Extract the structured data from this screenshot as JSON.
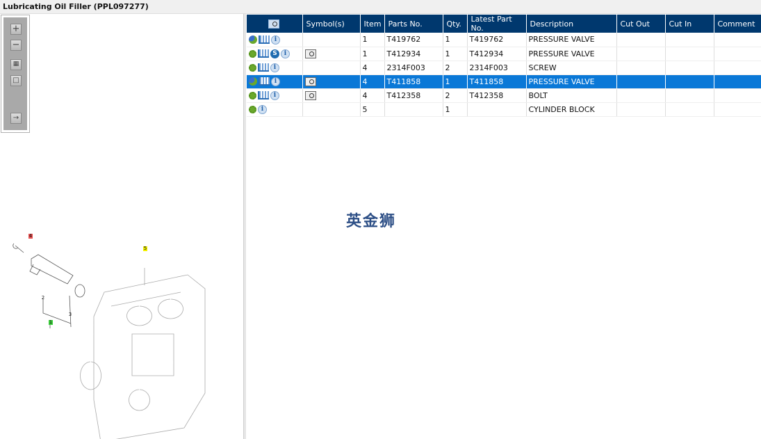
{
  "window": {
    "title": "Lubricating Oil Filler (PPL097277)"
  },
  "toolbar": {
    "tools": [
      "zoom-in",
      "zoom-out",
      "fit-all",
      "fit-window",
      "toggle-panel"
    ]
  },
  "diagram": {
    "callouts": [
      "4",
      "5",
      "1",
      "2",
      "3"
    ],
    "colors": {
      "4": "#e85050",
      "5": "#f2f000",
      "1": "#3bd13b"
    }
  },
  "table": {
    "headers": [
      "",
      "Symbol(s)",
      "Item",
      "Parts No.",
      "Qty.",
      "Latest Part No.",
      "Description",
      "Cut Out",
      "Cut In",
      "Comment"
    ],
    "rows": [
      {
        "icons": [
          "gears",
          "cart",
          "info"
        ],
        "symbol": false,
        "item": "1",
        "part": "T419762",
        "qty": "1",
        "latest": "T419762",
        "desc": "PRESSURE VALVE",
        "selected": false
      },
      {
        "icons": [
          "gear",
          "cart",
          "s",
          "info"
        ],
        "symbol": true,
        "item": "1",
        "part": "T412934",
        "qty": "1",
        "latest": "T412934",
        "desc": "PRESSURE VALVE",
        "selected": false
      },
      {
        "icons": [
          "gear",
          "cart",
          "info"
        ],
        "symbol": false,
        "item": "4",
        "part": "2314F003",
        "qty": "2",
        "latest": "2314F003",
        "desc": "SCREW",
        "selected": false
      },
      {
        "icons": [
          "gears",
          "cart",
          "info"
        ],
        "symbol": true,
        "item": "4",
        "part": "T411858",
        "qty": "1",
        "latest": "T411858",
        "desc": "PRESSURE VALVE",
        "selected": true
      },
      {
        "icons": [
          "gear",
          "cart",
          "info"
        ],
        "symbol": true,
        "item": "4",
        "part": "T412358",
        "qty": "2",
        "latest": "T412358",
        "desc": "BOLT",
        "selected": false
      },
      {
        "icons": [
          "gear",
          "info"
        ],
        "symbol": false,
        "item": "5",
        "part": "",
        "qty": "1",
        "latest": "",
        "desc": "CYLINDER BLOCK",
        "selected": false
      }
    ]
  },
  "watermark": "英金狮",
  "colors": {
    "header": "#00386e",
    "selected": "#0a78d7"
  }
}
